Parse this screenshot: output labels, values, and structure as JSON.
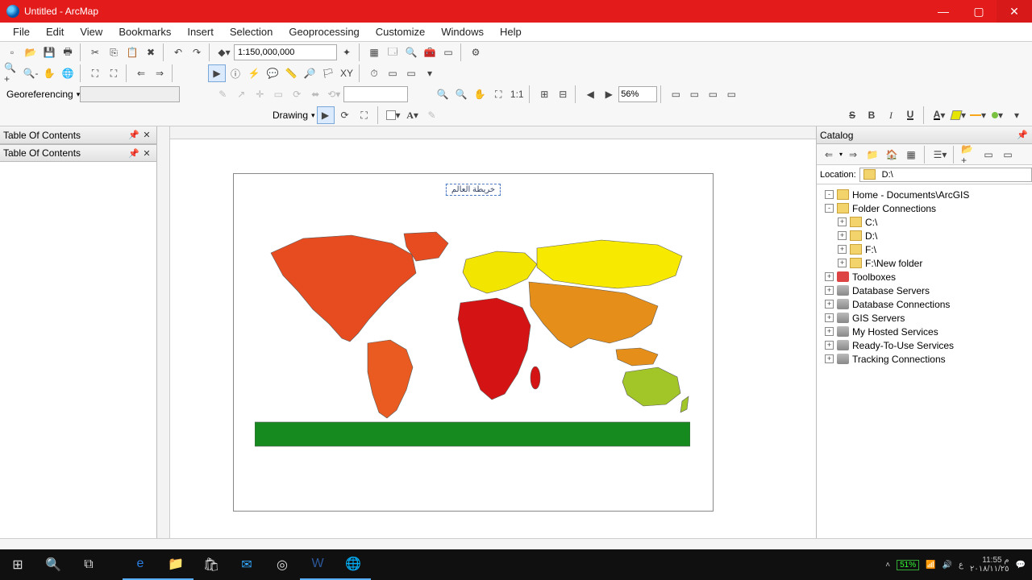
{
  "window": {
    "title": "Untitled - ArcMap"
  },
  "menu": [
    "File",
    "Edit",
    "View",
    "Bookmarks",
    "Insert",
    "Selection",
    "Geoprocessing",
    "Customize",
    "Windows",
    "Help"
  ],
  "toolbar": {
    "scale": "1:150,000,000",
    "georef_label": "Georeferencing",
    "drawing_label": "Drawing",
    "zoom_percent": "56%"
  },
  "toc": {
    "title": "Table Of Contents"
  },
  "map": {
    "title_text": "خريطة العالم",
    "colors": {
      "n_america": "#e74c20",
      "s_america": "#e95b20",
      "europe": "#f2e500",
      "asia_n": "#f7ea00",
      "asia_s": "#e58f1a",
      "africa": "#d41414",
      "australia": "#a2c627",
      "antarctica": "#168a1f"
    }
  },
  "catalog": {
    "title": "Catalog",
    "location_label": "Location:",
    "location_value": "D:\\",
    "tree": [
      {
        "exp": "-",
        "icon": "folder",
        "depth": 0,
        "label": "Home - Documents\\ArcGIS"
      },
      {
        "exp": "-",
        "icon": "folder",
        "depth": 0,
        "label": "Folder Connections"
      },
      {
        "exp": "+",
        "icon": "folder",
        "depth": 1,
        "label": "C:\\"
      },
      {
        "exp": "+",
        "icon": "folder",
        "depth": 1,
        "label": "D:\\"
      },
      {
        "exp": "+",
        "icon": "folder",
        "depth": 1,
        "label": "F:\\"
      },
      {
        "exp": "+",
        "icon": "folder",
        "depth": 1,
        "label": "F:\\New folder"
      },
      {
        "exp": "+",
        "icon": "tool",
        "depth": 0,
        "label": "Toolboxes"
      },
      {
        "exp": "+",
        "icon": "db",
        "depth": 0,
        "label": "Database Servers"
      },
      {
        "exp": "+",
        "icon": "db",
        "depth": 0,
        "label": "Database Connections"
      },
      {
        "exp": "+",
        "icon": "db",
        "depth": 0,
        "label": "GIS Servers"
      },
      {
        "exp": "+",
        "icon": "db",
        "depth": 0,
        "label": "My Hosted Services"
      },
      {
        "exp": "+",
        "icon": "db",
        "depth": 0,
        "label": "Ready-To-Use Services"
      },
      {
        "exp": "+",
        "icon": "db",
        "depth": 0,
        "label": "Tracking Connections"
      }
    ]
  },
  "taskbar": {
    "battery": "51%",
    "time": "11:55 م",
    "date": "٢٠١٨/١١/٢٥",
    "lang": "ع"
  }
}
